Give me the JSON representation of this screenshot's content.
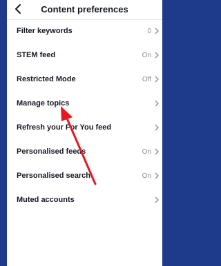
{
  "header": {
    "title": "Content preferences"
  },
  "items": [
    {
      "label": "Filter keywords",
      "value": "0"
    },
    {
      "label": "STEM feed",
      "value": "On"
    },
    {
      "label": "Restricted Mode",
      "value": "Off"
    },
    {
      "label": "Manage topics",
      "value": ""
    },
    {
      "label": "Refresh your For You feed",
      "value": ""
    },
    {
      "label": "Personalised feeds",
      "value": "On"
    },
    {
      "label": "Personalised search",
      "value": "On"
    },
    {
      "label": "Muted accounts",
      "value": ""
    }
  ],
  "colors": {
    "background": "#1e3a8a",
    "annotation_arrow": "#e01b24"
  },
  "icons": {
    "back": "chevron-left-icon",
    "row": "chevron-right-icon"
  }
}
